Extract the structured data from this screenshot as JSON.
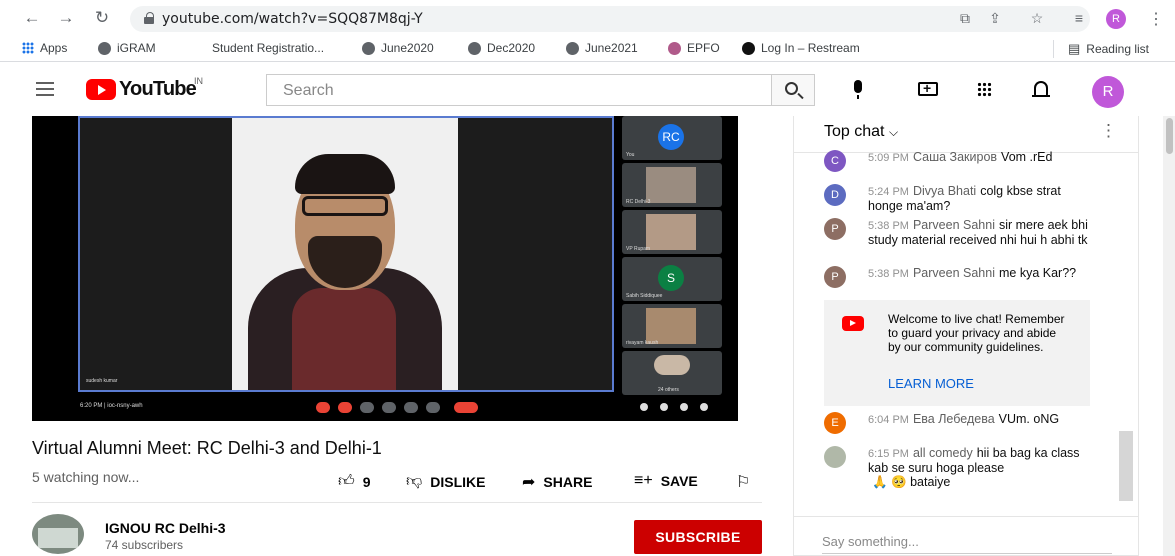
{
  "browser": {
    "url": "youtube.com/watch?v=SQQ87M8qj-Y",
    "profile_initial": "R",
    "bookmarks": [
      {
        "label": "Apps"
      },
      {
        "label": "iGRAM"
      },
      {
        "label": "Student Registratio..."
      },
      {
        "label": "June2020"
      },
      {
        "label": "Dec2020"
      },
      {
        "label": "June2021"
      },
      {
        "label": "EPFO"
      },
      {
        "label": "Log In – Restream"
      }
    ],
    "reading_list": "Reading list"
  },
  "header": {
    "logo_text": "YouTube",
    "country": "IN",
    "search_placeholder": "Search",
    "avatar_initial": "R"
  },
  "player": {
    "tiles": [
      {
        "initial": "RC",
        "label": "You",
        "color": "#1a73e8"
      },
      {
        "label": "RC Delhi-3"
      },
      {
        "label": "VP Rupam"
      },
      {
        "initial": "S",
        "label": "Sabih Siddiquee",
        "color": "#0b8043"
      },
      {
        "label": "rivayam kaush"
      },
      {
        "label": "24 others"
      }
    ],
    "speaker_label": "sudesh kumar",
    "bottom_text": "6:20 PM  |  ioc-nsny-awh"
  },
  "video": {
    "title": "Virtual Alumni Meet: RC Delhi-3 and Delhi-1",
    "watching": "5 watching now...",
    "likes": "9",
    "dislike": "DISLIKE",
    "share": "SHARE",
    "save": "SAVE"
  },
  "channel": {
    "name": "IGNOU RC Delhi-3",
    "subscribers": "74 subscribers",
    "subscribe": "SUBSCRIBE"
  },
  "chat": {
    "title": "Top chat",
    "messages": [
      {
        "initial": "C",
        "color": "#7e57c2",
        "time": "5:09 PM",
        "author": "Саша Закиров",
        "text": "Vom .rEd"
      },
      {
        "initial": "D",
        "color": "#5c6bc0",
        "time": "5:24 PM",
        "author": "Divya Bhati",
        "text": "colg kbse strat honge ma'am?"
      },
      {
        "initial": "P",
        "color": "#8d6e63",
        "time": "5:38 PM",
        "author": "Parveen Sahni",
        "text": "sir mere aek bhi study material received nhi hui h abhi tk"
      },
      {
        "initial": "P",
        "color": "#8d6e63",
        "time": "5:38 PM",
        "author": "Parveen Sahni",
        "text": "me kya Kar??"
      },
      {
        "initial": "E",
        "color": "#ef6c00",
        "time": "6:04 PM",
        "author": "Ева Лебедева",
        "text": "VUm. oNG"
      },
      {
        "initial": "",
        "color": "#b0b8a8",
        "time": "6:15 PM",
        "author": "all comedy",
        "text": "hii ba bag ka class kab se suru hoga please"
      },
      {
        "initial": "",
        "color": "",
        "time": "",
        "author": "",
        "text": "🙏 🥺 bataiye"
      }
    ],
    "welcome": {
      "text": "Welcome to live chat! Remember to guard your privacy and abide by our community guidelines.",
      "link": "LEARN MORE"
    },
    "input_placeholder": "Say something..."
  }
}
